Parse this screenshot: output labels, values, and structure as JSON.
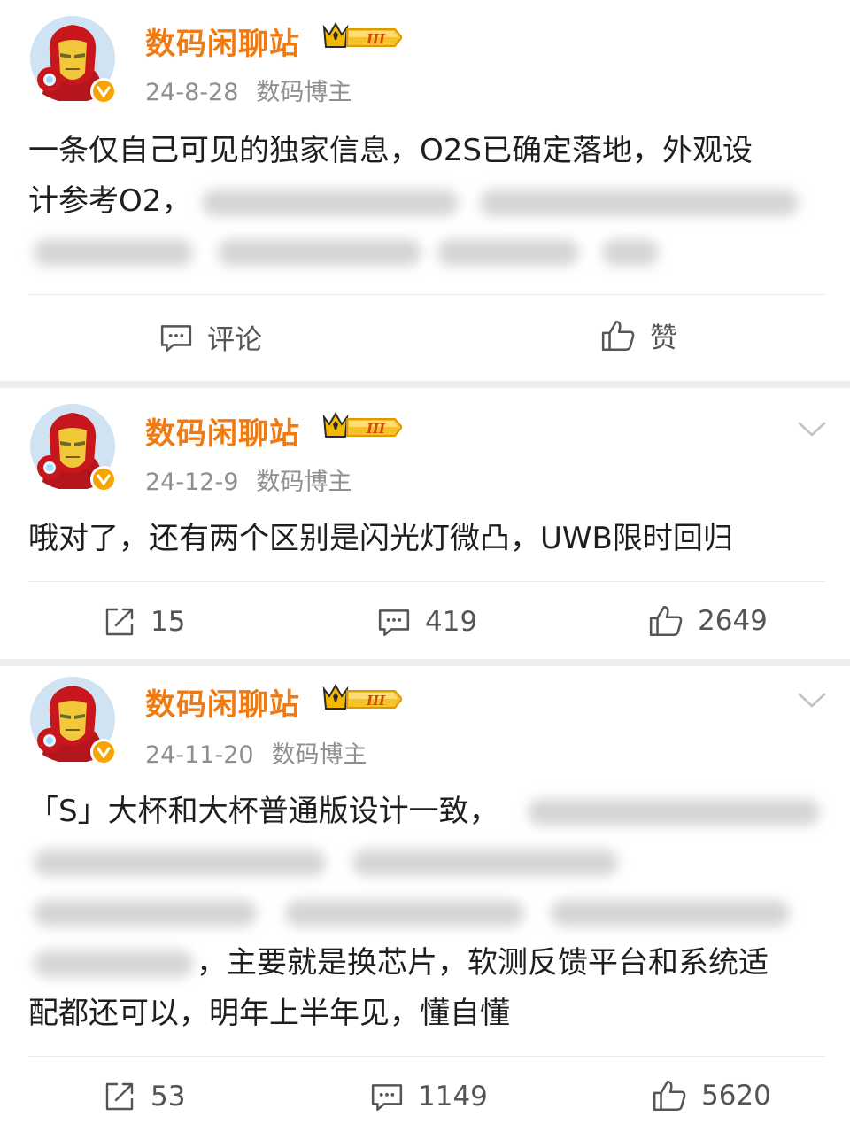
{
  "colors": {
    "name": "#f07a12",
    "meta": "#8f8f8f",
    "verify": "#f7a400",
    "badge": "#f5b800"
  },
  "posts": [
    {
      "author": "数码闲聊站",
      "level_badge": "III",
      "date": "24-8-28",
      "role": "数码博主",
      "text_line1": "一条仅自己可见的独家信息，O2S已确定落地，外观设",
      "text_line2": "计参考O2，",
      "actions": {
        "comment_label": "评论",
        "like_label": "赞"
      }
    },
    {
      "author": "数码闲聊站",
      "level_badge": "III",
      "date": "24-12-9",
      "role": "数码博主",
      "text_line1": "哦对了，还有两个区别是闪光灯微凸，UWB限时回归",
      "actions": {
        "reposts": "15",
        "comments": "419",
        "likes": "2649"
      }
    },
    {
      "author": "数码闲聊站",
      "level_badge": "III",
      "date": "24-11-20",
      "role": "数码博主",
      "text_line1": "「S」大杯和大杯普通版设计一致，",
      "text_line4": "，主要就是换芯片，软测反馈平台和系统适",
      "text_line5": "配都还可以，明年上半年见，懂自懂",
      "actions": {
        "reposts": "53",
        "comments": "1149",
        "likes": "5620"
      }
    }
  ],
  "icons": [
    "avatar-ironman",
    "verified-v-icon",
    "level-crown-icon",
    "chevron-down-icon",
    "comment-icon",
    "like-icon",
    "repost-icon"
  ]
}
